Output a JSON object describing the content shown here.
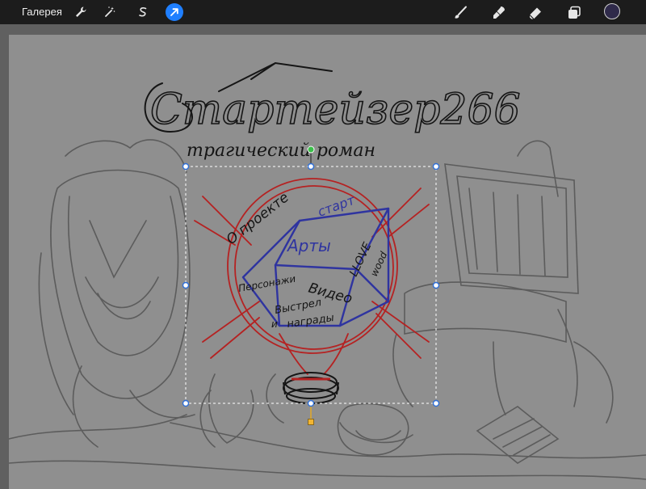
{
  "app": {
    "gallery_label": "Галерея",
    "left_tools": [
      {
        "name": "wrench-icon",
        "active": false
      },
      {
        "name": "magic-wand-icon",
        "active": false
      },
      {
        "name": "selection-s-icon",
        "active": false
      },
      {
        "name": "transform-arrow-icon",
        "active": true
      }
    ],
    "right_tools": [
      "brush-icon",
      "smudge-icon",
      "eraser-icon",
      "layers-icon"
    ],
    "current_color": "#2f2a4a",
    "accent_color": "#1f7fff"
  },
  "sketch": {
    "title": "Стартейзер266",
    "subtitle": "трагический роман",
    "words": {
      "o_proekte": "О проекте",
      "star": "старт",
      "arty": "Арты",
      "love": "LLOVE",
      "wood": "wood",
      "video": "Видео",
      "personazhi": "Персонажи",
      "vystrely": "Выстрел",
      "i": "и",
      "nagrady": "награды"
    }
  }
}
